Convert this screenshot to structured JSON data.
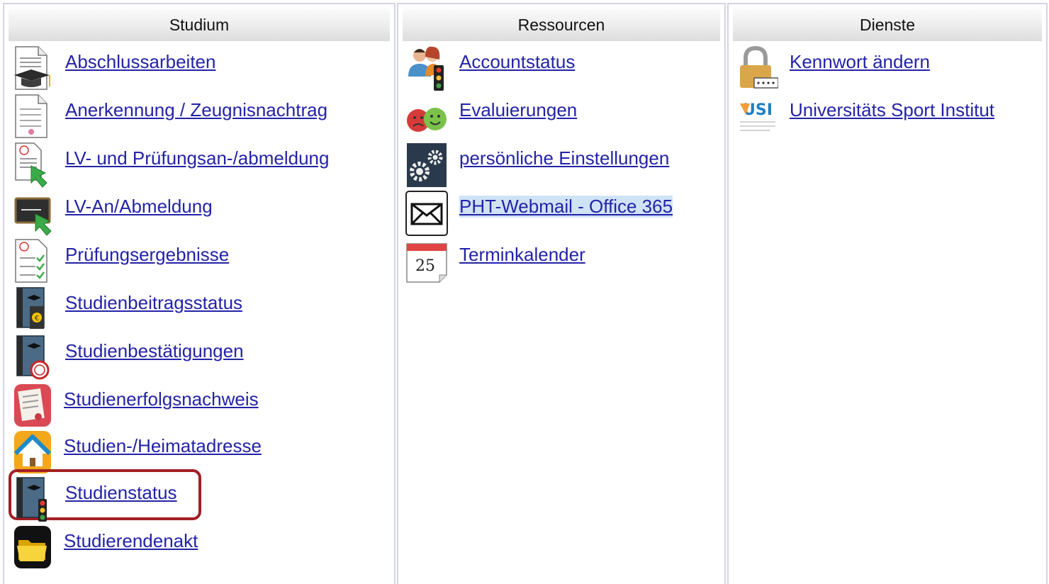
{
  "columns": [
    {
      "title": "Studium",
      "items": [
        {
          "label": "Abschlussarbeiten",
          "icon": "thesis-document-icon"
        },
        {
          "label": "Anerkennung / Zeugnisnachtrag",
          "icon": "certificate-icon"
        },
        {
          "label": "LV- und Prüfungsan-/abmeldung",
          "icon": "exam-registration-icon"
        },
        {
          "label": "LV-An/Abmeldung",
          "icon": "course-registration-icon"
        },
        {
          "label": "Prüfungsergebnisse",
          "icon": "exam-results-icon"
        },
        {
          "label": "Studienbeitragsstatus",
          "icon": "tuition-status-icon"
        },
        {
          "label": "Studienbestätigungen",
          "icon": "study-confirmation-icon"
        },
        {
          "label": "Studienerfolgsnachweis",
          "icon": "study-success-icon"
        },
        {
          "label": "Studien-/Heimatadresse",
          "icon": "home-address-icon"
        },
        {
          "label": "Studienstatus",
          "icon": "study-status-icon"
        },
        {
          "label": "Studierendenakt",
          "icon": "student-file-folder-icon"
        }
      ]
    },
    {
      "title": "Ressourcen",
      "items": [
        {
          "label": "Accountstatus",
          "icon": "account-status-icon"
        },
        {
          "label": "Evaluierungen",
          "icon": "evaluation-faces-icon"
        },
        {
          "label": "persönliche Einstellungen",
          "icon": "settings-gears-icon"
        },
        {
          "label": "PHT-Webmail - Office 365",
          "icon": "mail-envelope-icon"
        },
        {
          "label": "Terminkalender",
          "icon": "calendar-icon",
          "calendar_day": "25"
        }
      ]
    },
    {
      "title": "Dienste",
      "items": [
        {
          "label": "Kennwort ändern",
          "icon": "padlock-icon"
        },
        {
          "label": "Universitäts Sport Institut",
          "icon": "usi-logo-icon",
          "logo_text": "USI"
        }
      ]
    }
  ],
  "highlighted_item": "Studienstatus",
  "colors": {
    "link": "#2323a8",
    "selection_border": "#a31f24",
    "link_highlight": "#cfe3f6"
  }
}
